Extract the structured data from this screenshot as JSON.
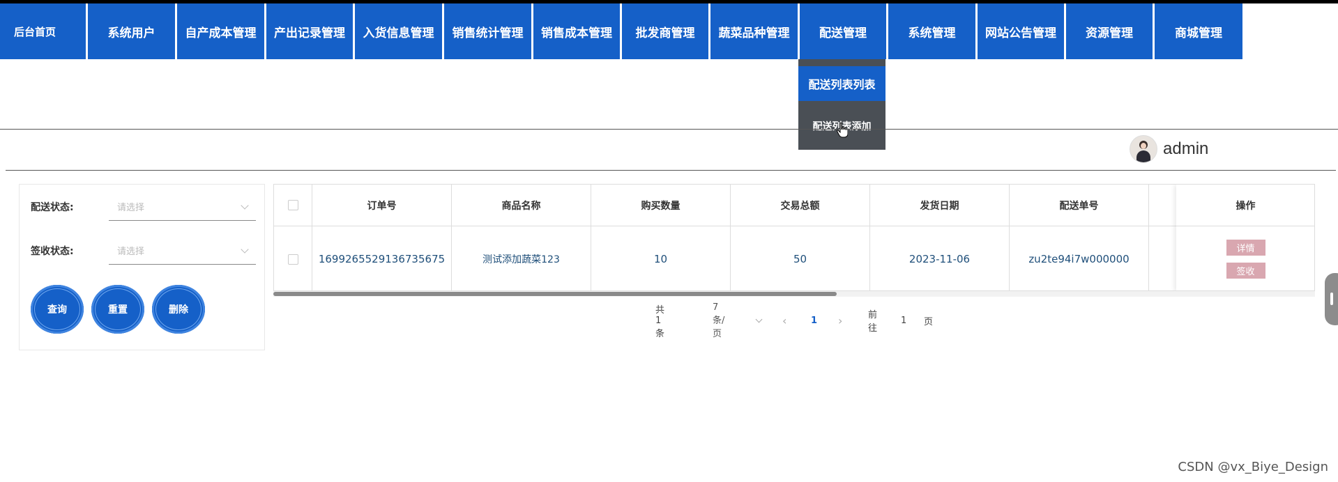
{
  "nav": {
    "items": [
      "后台首页",
      "系统用户",
      "自产成本管理",
      "产出记录管理",
      "入货信息管理",
      "销售统计管理",
      "销售成本管理",
      "批发商管理",
      "蔬菜品种管理",
      "配送管理",
      "系统管理",
      "网站公告管理",
      "资源管理",
      "商城管理"
    ],
    "dropdown": {
      "active": "配送列表列表",
      "item": "配送列表添加"
    }
  },
  "user": {
    "name": "admin"
  },
  "filter": {
    "delivery_status_label": "配送状态:",
    "delivery_status_placeholder": "请选择",
    "sign_status_label": "签收状态:",
    "sign_status_placeholder": "请选择",
    "query": "查询",
    "reset": "重置",
    "delete": "删除"
  },
  "table": {
    "headers": [
      "订单号",
      "商品名称",
      "购买数量",
      "交易总额",
      "发货日期",
      "配送单号",
      "操作"
    ],
    "rows": [
      {
        "order_no": "1699265529136735675",
        "product": "测试添加蔬菜123",
        "quantity": "10",
        "total": "50",
        "ship_date": "2023-11-06",
        "delivery_no": "zu2te94i7w000000",
        "detail": "详情",
        "sign": "签收"
      }
    ],
    "scroll_position": 0.54
  },
  "pagination": {
    "total": "共 1 条",
    "page_size": "7条/页",
    "prev": "‹",
    "current": "1",
    "next": "›",
    "goto_label": "前往",
    "goto_value": "1",
    "page_unit": "页"
  },
  "watermark": "CSDN @vx_Biye_Design",
  "colors": {
    "nav": "#1560c8",
    "dropdown": "#4a4f55",
    "op_button": "#d9a7b0"
  }
}
